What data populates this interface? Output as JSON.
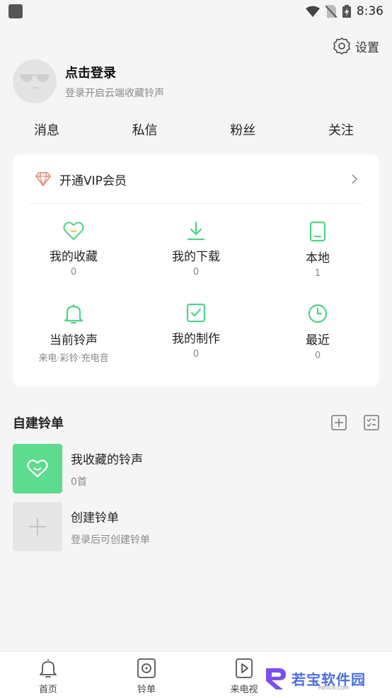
{
  "status_bar": {
    "time": "8:36"
  },
  "settings": {
    "label": "设置"
  },
  "profile": {
    "title": "点击登录",
    "subtitle": "登录开启云端收藏铃声"
  },
  "stats": [
    "消息",
    "私信",
    "粉丝",
    "关注"
  ],
  "vip": {
    "label": "开通VIP会员"
  },
  "grid": [
    {
      "label": "我的收藏",
      "count": "0",
      "icon": "heart-icon"
    },
    {
      "label": "我的下载",
      "count": "0",
      "icon": "download-icon"
    },
    {
      "label": "本地",
      "count": "1",
      "icon": "phone-icon"
    },
    {
      "label": "当前铃声",
      "count": "来电·彩铃·充电音",
      "icon": "bell-icon"
    },
    {
      "label": "我的制作",
      "count": "0",
      "icon": "checkbox-icon"
    },
    {
      "label": "最近",
      "count": "0",
      "icon": "clock-icon"
    }
  ],
  "playlist_section": {
    "title": "自建铃单"
  },
  "playlists": [
    {
      "title": "我收藏的铃声",
      "subtitle": "0首"
    },
    {
      "title": "创建铃单",
      "subtitle": "登录后可创建铃单"
    }
  ],
  "bottom_nav": [
    {
      "label": "首页"
    },
    {
      "label": "铃单"
    },
    {
      "label": "来电视"
    }
  ],
  "watermark": {
    "text": "若宝软件园",
    "sub": "RBSCN.COM"
  },
  "colors": {
    "accent": "#4fd38a",
    "vip": "#e5826d"
  }
}
